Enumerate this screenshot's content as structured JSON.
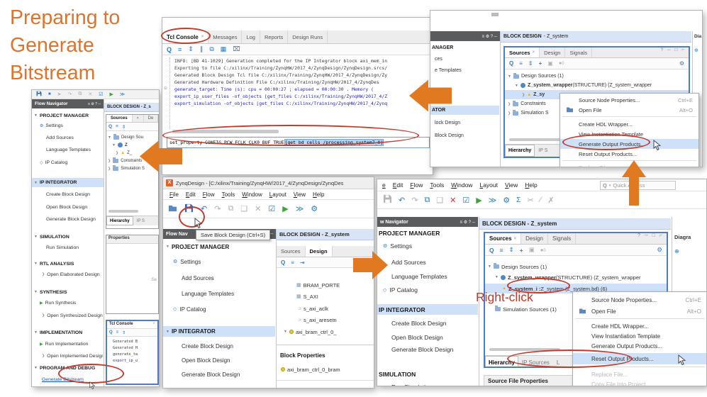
{
  "title": "Preparing to Generate Bitstream",
  "annotations": {
    "right_click": "Right-click"
  },
  "colors": {
    "title_orange": "#DE742C",
    "arrow_orange": "#E0791F",
    "annotation_red": "#C23B2C",
    "selection_blue": "#CEE1F8",
    "header_blue": "#D9E4F6"
  },
  "left": {
    "flow_nav_title": "Flow Navigator",
    "nav": [
      "PROJECT MANAGER",
      "Settings",
      "Add Sources",
      "Language Templates",
      "IP Catalog",
      "IP INTEGRATOR",
      "Create Block Design",
      "Open Block Design",
      "Generate Block Design",
      "SIMULATION",
      "Run Simulation",
      "RTL ANALYSIS",
      "Open Elaborated Design",
      "SYNTHESIS",
      "Run Synthesis",
      "Open Synthesized Design",
      "IMPLEMENTATION",
      "Run Implementation",
      "Open Implemented Design",
      "PROGRAM AND DEBUG",
      "Generate Bitstream"
    ],
    "block_design_header": "BLOCK DESIGN - Z_s",
    "sources_tab": "Sources",
    "sources_tab2": "De",
    "tree": [
      "Design Sou",
      "Z",
      "Z_",
      "Constraints",
      "Simulation S"
    ],
    "hierarchy_tab": "Hierarchy",
    "ip_sources_tab": "IP S",
    "properties_header": "Properties",
    "properties_hint": "Se",
    "tcl_tab": "Tcl Console",
    "tcl_lines": [
      "Generated B",
      "Generated H",
      "generate_ta",
      "export_ip_u"
    ]
  },
  "tcl": {
    "tabs": [
      "Tcl Console",
      "Messages",
      "Log",
      "Reports",
      "Design Runs"
    ],
    "lines": [
      "INFO: [BD 41-1029] Generation completed for the IP Integrator block axi_mem_in",
      "Exporting to file C:/xilinx/Training/ZynqHW/2017_4/ZynqDesign/ZynqDesign.srcs/",
      "Generated Block Design Tcl file C:/xilinx/Training/ZynqHW/2017_4/ZynqDesign/Zy",
      "Generated Hardware Definition File C:/xilinx/Training/ZynqHW/2017_4/ZynqDes",
      "generate_target: Time (s): cpu = 00:00:27 ; elapsed = 00:00:30 . Memory (",
      "export_ip_user_files -of_objects [get_files C:/xilinx/Training/ZynqHW/2017_4/Z",
      "export_simulation -of_objects [get_files C:/xilinx/Training/ZynqHW/2017_4/Zynq"
    ],
    "command_plain": "set_property CONFIG.PCW_FCLK_CLK0_BUF TRUE ",
    "command_selected": "[get_bd_cells /processing_system7_0]"
  },
  "topright": {
    "nav_partial": [
      "ANAGER",
      "ces",
      "e Templates",
      "ATOR",
      "lock Design",
      "Block Design"
    ],
    "block_design_title": "BLOCK DESIGN",
    "block_design_doc": "- Z_system",
    "tabs": {
      "sources": "Sources",
      "design": "Design",
      "signals": "Signals"
    },
    "badge": "0",
    "tree": {
      "design_sources": "Design Sources (1)",
      "wrapper_bold": "Z_system_wrapper",
      "wrapper_rest": "(STRUCTURE) (Z_system_wrapper",
      "child": "Z_sy",
      "constraints": "Constraints",
      "sim_sources": "Simulation S"
    },
    "hierarchy_tab": "Hierarchy",
    "ip_sources_tab": "IP S",
    "diagram_label": "Dia",
    "menu": [
      {
        "label": "Source Node Properties...",
        "shortcut": "Ctrl+E"
      },
      {
        "label": "Open File",
        "shortcut": "Alt+O"
      },
      {
        "label": "Create HDL Wrapper..."
      },
      {
        "label": "View Instantiation Template"
      },
      {
        "label": "Generate Output Products..."
      },
      {
        "label": "Reset Output Products..."
      },
      {
        "label": "Replace File..."
      }
    ]
  },
  "bottomcenter": {
    "window_title": "ZynqDesign - [C:/xilinx/Training/ZynqHW/2017_4/ZynqDesign/ZynqDes",
    "menus": [
      "File",
      "Edit",
      "Flow",
      "Tools",
      "Window",
      "Layout",
      "View",
      "Help"
    ],
    "tooltip": "Save Block Design (Ctrl+S)",
    "flow_nav_title": "Flow Nav",
    "block_design_header": "BLOCK DESIGN - Z_system",
    "nav": [
      "PROJECT MANAGER",
      "Settings",
      "Add Sources",
      "Language Templates",
      "IP Catalog",
      "IP INTEGRATOR",
      "Create Block Design",
      "Open Block Design",
      "Generate Block Design"
    ],
    "tabs": {
      "sources": "Sources",
      "design": "Design"
    },
    "tree": [
      "BRAM_PORTE",
      "S_AXI",
      "s_axi_aclk",
      "s_axi_aresetn",
      "axi_bram_ctrl_0_"
    ],
    "block_properties_header": "Block Properties",
    "block_properties_item": "axi_bram_ctrl_0_bram"
  },
  "bottomright": {
    "menus": [
      "e",
      "Edit",
      "Flow",
      "Tools",
      "Window",
      "Layout",
      "View",
      "Help"
    ],
    "quick_access": "Quick Access",
    "flow_nav_title": "w Navigator",
    "block_design_header": "BLOCK DESIGN - Z_system",
    "nav": [
      "PROJECT MANAGER",
      "Settings",
      "Add Sources",
      "Language Templates",
      "IP Catalog",
      "IP INTEGRATOR",
      "Create Block Design",
      "Open Block Design",
      "Generate Block Design",
      "SIMULATION",
      "Run Simulation"
    ],
    "tabs": {
      "sources": "Sources",
      "design": "Design",
      "signals": "Signals"
    },
    "badge": "0",
    "tree": {
      "design_sources": "Design Sources (1)",
      "wrapper_bold": "Z_system_wrapper",
      "wrapper_rest": "(STRUCTURE) (Z_system_wrapper",
      "z_bold": "Z_system_i :",
      "z_rest": " Z_system (Z_system.bd) (6)",
      "sim_sources": "Simulation Sources (1)"
    },
    "hierarchy_tab": "Hierarchy",
    "ip_sources_tab": "IP Sources",
    "libraries_tab": "L",
    "source_file_properties": "Source File Properties",
    "diagram_label": "Diagra",
    "menu": [
      {
        "label": "Source Node Properties...",
        "shortcut": "Ctrl+E"
      },
      {
        "label": "Open File",
        "shortcut": "Alt+O"
      },
      {
        "label": "Create HDL Wrapper..."
      },
      {
        "label": "View Instantiation Template"
      },
      {
        "label": "Generate Output Products..."
      },
      {
        "label": "Reset Output Products..."
      },
      {
        "label": "Replace File..."
      },
      {
        "label": "Copy File Into Project"
      }
    ]
  }
}
